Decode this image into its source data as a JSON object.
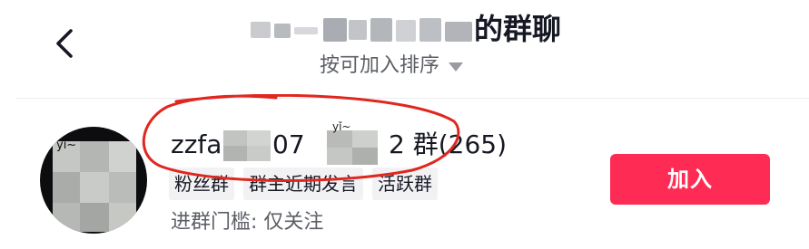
{
  "header": {
    "back_icon": "chevron-left-icon",
    "title_suffix": "的群聊",
    "sort_label": "按可加入排序",
    "sort_icon": "caret-down-icon"
  },
  "group": {
    "name_start": "zzfa",
    "name_mid": "07",
    "name_end": "2 群(265)",
    "blur_label": "yǐ~",
    "avatar_label": "yǐ~",
    "tags": [
      "粉丝群",
      "群主近期发言",
      "活跃群"
    ],
    "entry_requirement": "进群门槛: 仅关注",
    "join_label": "加入"
  },
  "colors": {
    "accent": "#fe2c55",
    "annotation": "#e0271f",
    "text_primary": "#161823",
    "text_secondary": "#5c5f66",
    "chip_bg": "#f2f2f4"
  }
}
